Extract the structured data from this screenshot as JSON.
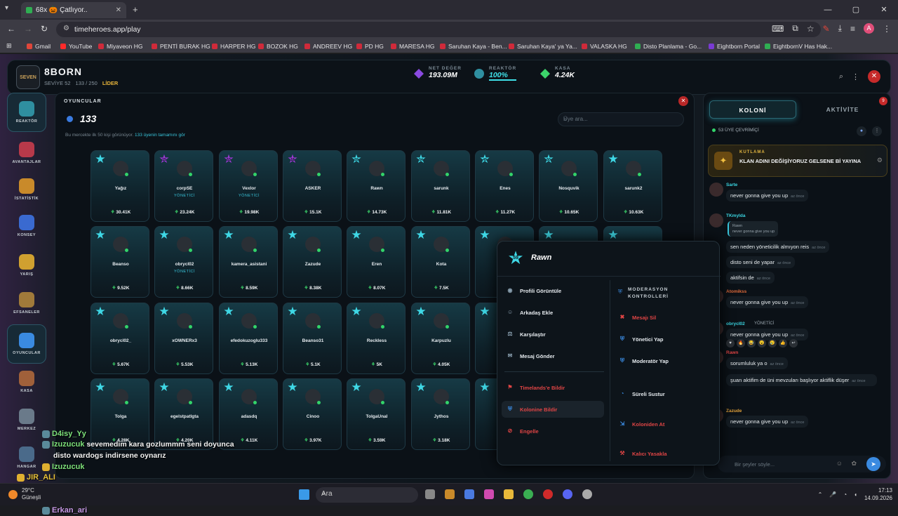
{
  "browser": {
    "tab_title": "68x 🎃 Çatlıyor..",
    "url": "timeheroes.app/play",
    "profile_letter": "A",
    "bookmarks": [
      {
        "label": "Gmail",
        "color": "#e0463a"
      },
      {
        "label": "YouTube",
        "color": "#ff2a2a"
      },
      {
        "label": "Miyaveon HG",
        "color": "#d02a3a"
      },
      {
        "label": "PENTİ BURAK HG",
        "color": "#d02a3a"
      },
      {
        "label": "HARPER HG",
        "color": "#d02a3a"
      },
      {
        "label": "BOZOK HG",
        "color": "#d02a3a"
      },
      {
        "label": "ANDREEV HG",
        "color": "#d02a3a"
      },
      {
        "label": "PD HG",
        "color": "#d02a3a"
      },
      {
        "label": "MARESA HG",
        "color": "#d02a3a"
      },
      {
        "label": "Saruhan Kaya - Ben...",
        "color": "#d02a3a"
      },
      {
        "label": "Saruhan Kaya' ya Ya...",
        "color": "#d02a3a"
      },
      {
        "label": "VALASKA HG",
        "color": "#d02a3a"
      },
      {
        "label": "Disto Planlama - Go...",
        "color": "#2fae52"
      },
      {
        "label": "Eightborn Portal",
        "color": "#7a3ad3"
      },
      {
        "label": "EightbornV Has Hak...",
        "color": "#2fae52"
      }
    ]
  },
  "header": {
    "clan_name": "8BORN",
    "level": "SEVİYE 52",
    "members": "133 / 250",
    "role": "LİDER",
    "net_label": "NET DEĞER",
    "net_value": "193.09M",
    "reactor_label": "REAKTÖR",
    "reactor_value": "100%",
    "vault_label": "KASA",
    "vault_value": "4.24K"
  },
  "nav": [
    {
      "label": "REAKTÖR",
      "color": "#2f8fa0"
    },
    {
      "label": "AVANTAJLAR",
      "color": "#b8394a"
    },
    {
      "label": "İSTATİSTİK",
      "color": "#c98a2a"
    },
    {
      "label": "KONSEY",
      "color": "#3a6ad0"
    },
    {
      "label": "YARIŞ",
      "color": "#d0a030"
    },
    {
      "label": "EFSANELER",
      "color": "#a07a3a"
    },
    {
      "label": "OYUNCULAR",
      "color": "#3a8ae0"
    },
    {
      "label": "KASA",
      "color": "#a0603a"
    },
    {
      "label": "MERKEZ",
      "color": "#6a7a8a"
    },
    {
      "label": "HANGAR",
      "color": "#4a6a8a"
    }
  ],
  "players_panel": {
    "title": "OYUNCULAR",
    "count": "133",
    "note": "Bu mercekte ilk 50 kişi görünüyor.",
    "note_link": "133 üyenin tamamını gör",
    "search_placeholder": "Üye ara..."
  },
  "players": [
    {
      "name": "Yağız",
      "role": "",
      "power": "30.41K",
      "lvl": "",
      "star": "teal"
    },
    {
      "name": "corpSE",
      "role": "YÖNETİCİ",
      "power": "23.24K",
      "lvl": "15",
      "star": "purple"
    },
    {
      "name": "Vexlor",
      "role": "YÖNETİCİ",
      "power": "19.98K",
      "lvl": "53",
      "star": "purple"
    },
    {
      "name": "ASKER",
      "role": "",
      "power": "15.1K",
      "lvl": "18",
      "star": "purple"
    },
    {
      "name": "Rawn",
      "role": "",
      "power": "14.73K",
      "lvl": "59",
      "star": "teal"
    },
    {
      "name": "sarunk",
      "role": "",
      "power": "11.81K",
      "lvl": "54",
      "star": "teal"
    },
    {
      "name": "Enes",
      "role": "",
      "power": "11.27K",
      "lvl": "49",
      "star": "teal"
    },
    {
      "name": "Nosquvik",
      "role": "",
      "power": "10.65K",
      "lvl": "50",
      "star": "teal"
    },
    {
      "name": "sarunk2",
      "role": "",
      "power": "10.63K",
      "lvl": "",
      "star": "teal"
    },
    {
      "name": "Beanso",
      "role": "",
      "power": "9.52K",
      "lvl": "",
      "star": "teal"
    },
    {
      "name": "obrycl02",
      "role": "YÖNETİCİ",
      "power": "8.66K",
      "lvl": "",
      "star": "teal"
    },
    {
      "name": "kamera_asistani",
      "role": "",
      "power": "8.59K",
      "lvl": "",
      "star": "teal"
    },
    {
      "name": "Zazude",
      "role": "",
      "power": "8.38K",
      "lvl": "",
      "star": "teal"
    },
    {
      "name": "Eren",
      "role": "",
      "power": "8.07K",
      "lvl": "",
      "star": "teal"
    },
    {
      "name": "Kota",
      "role": "",
      "power": "7.5K",
      "lvl": "",
      "star": "teal"
    },
    {
      "name": "TK",
      "role": "",
      "power": "",
      "lvl": "",
      "star": "teal"
    },
    {
      "name": "",
      "role": "",
      "power": "",
      "lvl": "",
      "star": "teal"
    },
    {
      "name": "",
      "role": "",
      "power": "",
      "lvl": "",
      "star": "teal"
    },
    {
      "name": "obrycl02_",
      "role": "",
      "power": "5.67K",
      "lvl": "",
      "star": "teal"
    },
    {
      "name": "xOWNERx3",
      "role": "",
      "power": "5.53K",
      "lvl": "",
      "star": "teal"
    },
    {
      "name": "efedokuzoglu333",
      "role": "",
      "power": "5.13K",
      "lvl": "",
      "star": "teal"
    },
    {
      "name": "Beanso31",
      "role": "",
      "power": "5.1K",
      "lvl": "",
      "star": "teal"
    },
    {
      "name": "Reckless",
      "role": "",
      "power": "5K",
      "lvl": "",
      "star": "teal"
    },
    {
      "name": "Karpuzlu",
      "role": "",
      "power": "4.05K",
      "lvl": "",
      "star": "teal"
    },
    {
      "name": "d",
      "role": "",
      "power": "",
      "lvl": "",
      "star": "teal"
    },
    {
      "name": "",
      "role": "",
      "power": "",
      "lvl": "",
      "star": "teal"
    },
    {
      "name": "",
      "role": "",
      "power": "",
      "lvl": "",
      "star": "teal"
    },
    {
      "name": "Tolga",
      "role": "",
      "power": "4.28K",
      "lvl": "",
      "star": "teal"
    },
    {
      "name": "egelstpatlgta",
      "role": "",
      "power": "4.20K",
      "lvl": "",
      "star": "teal"
    },
    {
      "name": "adasdq",
      "role": "",
      "power": "4.11K",
      "lvl": "",
      "star": "teal"
    },
    {
      "name": "Cinoo",
      "role": "",
      "power": "3.97K",
      "lvl": "",
      "star": "teal"
    },
    {
      "name": "TolgaUnal",
      "role": "",
      "power": "3.59K",
      "lvl": "",
      "star": "teal"
    },
    {
      "name": "Jythos",
      "role": "",
      "power": "3.18K",
      "lvl": "",
      "star": "teal"
    },
    {
      "name": "M",
      "role": "",
      "power": "",
      "lvl": "",
      "star": "teal"
    }
  ],
  "context_menu": {
    "name": "Rawn",
    "level": "59",
    "left": [
      "Profili Görüntüle",
      "Arkadaş Ekle",
      "Karşılaştır",
      "Mesaj Gönder"
    ],
    "report": [
      "Timelands'e Bildir",
      "Kolonine Bildir",
      "Engelle"
    ],
    "mod_title": "MODERASYON KONTROLLERİ",
    "mod": [
      "Mesajı Sil",
      "Yönetici Yap",
      "Moderatör Yap",
      "Süreli Sustur",
      "Koloniden At",
      "Kalıcı Yasakla"
    ]
  },
  "chat": {
    "tab_active": "KOLONİ",
    "tab_other": "AKTİVİTE",
    "badge": "9",
    "online": "53 ÜYE ÇEVRİMİÇİ",
    "announce_title": "KUTLAMA",
    "announce_text": "KLAN ADINI DEĞİŞİYORUZ GELSENE Bİ YAYINA",
    "messages": [
      {
        "user": "Sarte",
        "text": "never gonna give you up",
        "time": "az önce"
      },
      {
        "user": "TKmylda",
        "reply_user": "Rawn",
        "reply_text": "never gonna give you up",
        "text": "sen neden yöneticilik almıyon reis",
        "time": "az önce"
      },
      {
        "text": "disto seni de yapar",
        "time": "az önce"
      },
      {
        "text": "aktifsin de",
        "time": "az önce"
      },
      {
        "user": "Atomikss",
        "text": "never gonna give you up",
        "time": "az önce"
      },
      {
        "user": "obrycl02",
        "role": "YÖNETİCİ",
        "text": "never gonna give you up",
        "time": "az önce"
      },
      {
        "user": "Rawn",
        "text": "sorumluluk ya o",
        "time": "az önce"
      },
      {
        "text": "şuan aktifim de üni mevzuları başlıyor aktiflik düşer",
        "time": "az önce"
      },
      {
        "user": "Zazude",
        "text": "never gonna give you up",
        "time": "az önce"
      }
    ],
    "input_placeholder": "Bir şeyler söyle..."
  },
  "stream_chat": [
    {
      "user": "D4isy_Yy",
      "text": "",
      "color": "#7de07a"
    },
    {
      "user": "Izuzucuk",
      "text": "sevemedim kara gozlummm seni doyunca",
      "color": "#7de07a"
    },
    {
      "user": "",
      "text": "disto wardogs indirsene oynarız",
      "color": "#7de07a"
    },
    {
      "user": "Izuzucuk",
      "text": "",
      "color": "#7de07a"
    },
    {
      "user": "JIR_ALI",
      "text": "",
      "color": "#e8c13a"
    },
    {
      "user": "Caelestis_91",
      "text": "Size var yaaaaa neyse dşfjgifjfkfjfkg",
      "color": "#e04050"
    },
    {
      "user": "Izuzucuk",
      "text": "",
      "color": "#7de07a"
    },
    {
      "user": "Erkan_ari",
      "text": "",
      "color": "#c89ae8"
    }
  ],
  "taskbar": {
    "temp": "29°C",
    "weather": "Güneşli",
    "search": "Ara",
    "time": "17:13",
    "date": "14.09.2026"
  }
}
